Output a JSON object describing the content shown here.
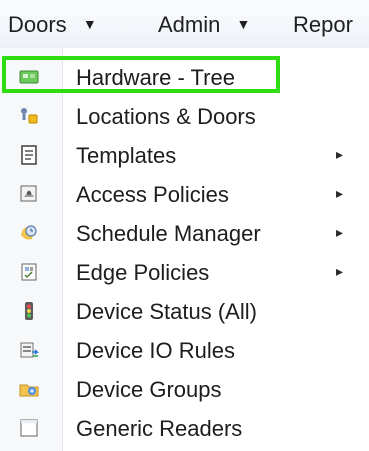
{
  "menubar": {
    "items": [
      {
        "label": "Doors",
        "caret": "▼"
      },
      {
        "label": "Admin",
        "caret": "▼"
      },
      {
        "label": "Repor"
      }
    ]
  },
  "dropdown": {
    "items": [
      {
        "label": "Hardware - Tree",
        "icon": "hardware-tree-icon",
        "submenu": ""
      },
      {
        "label": "Locations & Doors",
        "icon": "locations-doors-icon",
        "submenu": ""
      },
      {
        "label": "Templates",
        "icon": "templates-icon",
        "submenu": "▸"
      },
      {
        "label": "Access Policies",
        "icon": "access-policies-icon",
        "submenu": "▸"
      },
      {
        "label": "Schedule Manager",
        "icon": "schedule-manager-icon",
        "submenu": "▸"
      },
      {
        "label": "Edge Policies",
        "icon": "edge-policies-icon",
        "submenu": "▸"
      },
      {
        "label": "Device Status (All)",
        "icon": "device-status-icon",
        "submenu": ""
      },
      {
        "label": "Device IO Rules",
        "icon": "device-io-rules-icon",
        "submenu": ""
      },
      {
        "label": "Device Groups",
        "icon": "device-groups-icon",
        "submenu": ""
      },
      {
        "label": "Generic Readers",
        "icon": "generic-readers-icon",
        "submenu": ""
      }
    ]
  },
  "colors": {
    "highlight": "#2fdd12"
  }
}
